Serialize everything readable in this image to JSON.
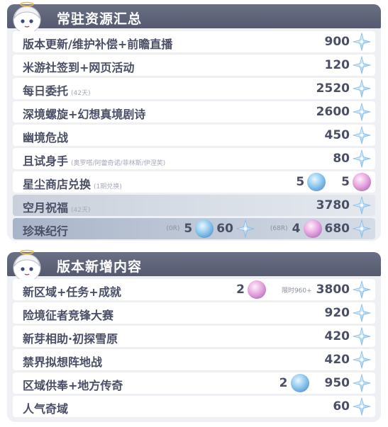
{
  "panels": [
    {
      "title": "常驻资源汇总",
      "rows": [
        {
          "label": "版本更新/维护补偿+前瞻直播",
          "note": "",
          "value": "900"
        },
        {
          "label": "米游社签到+网页活动",
          "note": "",
          "value": "120"
        },
        {
          "label": "每日委托",
          "note": "(42天)",
          "value": "2520"
        },
        {
          "label": "深境螺旋+幻想真境剧诗",
          "note": "",
          "value": "2600"
        },
        {
          "label": "幽境危战",
          "note": "",
          "value": "450"
        },
        {
          "label": "且试身手",
          "note": "(奥罗嗒/阿蕾奇诺/菲林斯/伊涅芙)",
          "value": "80"
        },
        {
          "label": "星尘商店兑换",
          "note": "(1期兑换)",
          "blue_count": "5",
          "pink_count": "5"
        },
        {
          "label": "空月祝福",
          "note": "(42天)",
          "value": "3780"
        },
        {
          "label": "珍珠纪行",
          "note": "",
          "tag_0r": "(0R)",
          "blue_count": "5",
          "value_0r": "60",
          "tag_68r": "(68R)",
          "pink_count": "4",
          "value": "680"
        }
      ]
    },
    {
      "title": "版本新增内容",
      "rows": [
        {
          "label": "新区域+任务+成就",
          "note": "",
          "pink_count": "2",
          "limit_note": "限时960+",
          "value": "3800"
        },
        {
          "label": "险境征者竞锋大赛",
          "note": "",
          "value": "920"
        },
        {
          "label": "新芽相助·初探雪原",
          "note": "",
          "value": "420"
        },
        {
          "label": "禁界拟想阵地战",
          "note": "",
          "value": "420"
        },
        {
          "label": "区域供奉+地方传奇",
          "note": "",
          "blue_count": "2",
          "value": "950"
        },
        {
          "label": "人气奇域",
          "note": "",
          "value": "60"
        }
      ]
    }
  ],
  "icons": {
    "primogem": "primogem-star-icon",
    "intertwined_fate": "blue-fate-orb-icon",
    "acquaint_fate": "pink-fate-orb-icon",
    "mascot": "paimon-mascot-icon"
  },
  "colors": {
    "header": "#5d6277",
    "panel_bg": "#eef0f4",
    "text": "#4a4f66",
    "note": "#a6aab8"
  }
}
